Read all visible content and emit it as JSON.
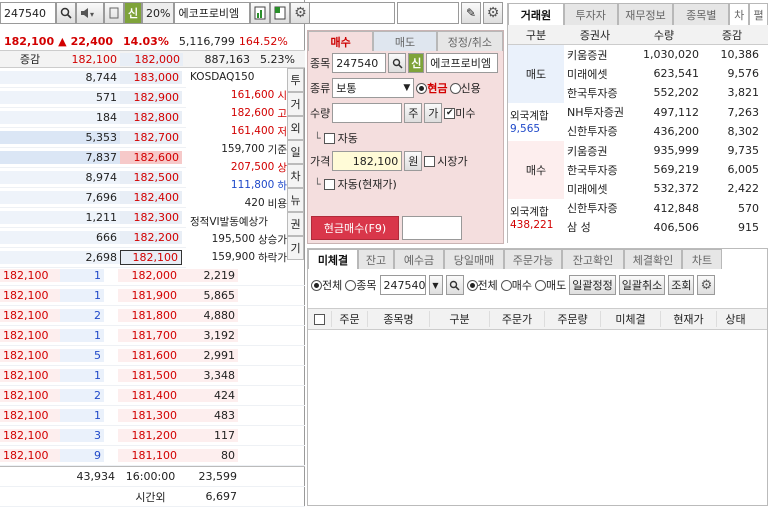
{
  "colors": {
    "accent_red": "#d20000",
    "accent_blue": "#1f49c9",
    "ask_bg": "#eaf1fb",
    "bid_bg": "#fdeeee",
    "buy_panel": "#f4dede",
    "brand_green": "#6a9a2a"
  },
  "left": {
    "code": "247540",
    "badge": "신",
    "pct_badge": "20%",
    "stock_name": "에코프로비엠",
    "price": "182,100",
    "arrow": "▲",
    "change": "22,400",
    "change_pct": "14.03%",
    "volume": "5,116,799",
    "vol_ratio": "164.52%",
    "hdr_label": "증감",
    "hdr_price_l": "182,100",
    "hdr_price_m": "182,000",
    "hdr_right": "887,163",
    "hdr_right2": "5.23%",
    "asks": [
      {
        "qty": "8,744",
        "price": "183,000"
      },
      {
        "qty": "571",
        "price": "182,900"
      },
      {
        "qty": "184",
        "price": "182,800"
      },
      {
        "qty": "5,353",
        "price": "182,700"
      },
      {
        "qty": "7,837",
        "price": "182,600"
      },
      {
        "qty": "8,974",
        "price": "182,500"
      },
      {
        "qty": "7,696",
        "price": "182,400"
      },
      {
        "qty": "1,211",
        "price": "182,300"
      },
      {
        "qty": "666",
        "price": "182,200"
      },
      {
        "qty": "2,698",
        "price": "182,100"
      }
    ],
    "info_lines": [
      {
        "label": "KOSDAQ150",
        "val": ""
      },
      {
        "label": "시",
        "val": "161,600"
      },
      {
        "label": "고",
        "val": "182,600"
      },
      {
        "label": "저",
        "val": "161,400"
      },
      {
        "label": "기준",
        "val": "159,700"
      },
      {
        "label": "상",
        "val": "207,500"
      },
      {
        "label": "하",
        "val": "111,800"
      },
      {
        "label": "비용",
        "val": "420"
      },
      {
        "label": "정적VI발동예상가",
        "val": ""
      },
      {
        "label": "상승가",
        "val": "195,500"
      },
      {
        "label": "하락가",
        "val": "159,900"
      }
    ],
    "side_tabs": [
      "투",
      "거",
      "외",
      "일",
      "차",
      "뉴",
      "권",
      "기"
    ],
    "bids": [
      {
        "p": "182,100",
        "n": "1",
        "price": "182,000",
        "qty": "2,219"
      },
      {
        "p": "182,100",
        "n": "1",
        "price": "181,900",
        "qty": "5,865"
      },
      {
        "p": "182,100",
        "n": "2",
        "price": "181,800",
        "qty": "4,880"
      },
      {
        "p": "182,100",
        "n": "1",
        "price": "181,700",
        "qty": "3,192"
      },
      {
        "p": "182,100",
        "n": "5",
        "price": "181,600",
        "qty": "2,991"
      },
      {
        "p": "182,100",
        "n": "1",
        "price": "181,500",
        "qty": "3,348"
      },
      {
        "p": "182,100",
        "n": "2",
        "price": "181,400",
        "qty": "424"
      },
      {
        "p": "182,100",
        "n": "1",
        "price": "181,300",
        "qty": "483"
      },
      {
        "p": "182,100",
        "n": "3",
        "price": "181,200",
        "qty": "117"
      },
      {
        "p": "182,100",
        "n": "9",
        "price": "181,100",
        "qty": "80"
      }
    ],
    "total_ask": "43,934",
    "time": "16:00:00",
    "total_bid": "23,599",
    "after_label": "시간외",
    "after_val": "6,697"
  },
  "order": {
    "tabs": [
      "매수",
      "매도",
      "정정/취소"
    ],
    "code_label": "종목",
    "code": "247540",
    "badge": "신",
    "name": "에코프로비엠",
    "type_label": "종류",
    "type_val": "보통",
    "cash": "현금",
    "credit": "신용",
    "qty_label": "수량",
    "btn_ju": "주",
    "btn_ga": "가",
    "unfilled": "미수",
    "auto": "자동",
    "price_label": "가격",
    "price_val": "182,100",
    "won": "원",
    "market": "시장가",
    "auto2": "자동(현재가)",
    "submit": "현금매수(F9)"
  },
  "broker": {
    "tabs": [
      "거래원",
      "투자자",
      "재무정보",
      "종목별",
      "차",
      "펼"
    ],
    "headers": [
      "구분",
      "증권사",
      "수량",
      "증감"
    ],
    "sell_label": "매도",
    "buy_label": "매수",
    "sells": [
      {
        "name": "키움증권",
        "qty": "1,030,020",
        "chg": "10,386"
      },
      {
        "name": "미래에셋",
        "qty": "623,541",
        "chg": "9,576"
      },
      {
        "name": "한국투자증",
        "qty": "552,202",
        "chg": "3,821"
      },
      {
        "name": "NH투자증권",
        "qty": "497,112",
        "chg": "7,263"
      },
      {
        "name": "신한투자증",
        "qty": "436,200",
        "chg": "8,302"
      }
    ],
    "buys": [
      {
        "name": "키움증권",
        "qty": "935,999",
        "chg": "9,735"
      },
      {
        "name": "한국투자증",
        "qty": "569,219",
        "chg": "6,005"
      },
      {
        "name": "미래에셋",
        "qty": "532,372",
        "chg": "2,422"
      },
      {
        "name": "신한투자증",
        "qty": "412,848",
        "chg": "570"
      },
      {
        "name": "삼   성",
        "qty": "406,506",
        "chg": "915"
      }
    ],
    "foreign_label": "외국계합",
    "foreign_sell": "9,565",
    "foreign_buy": "438,221"
  },
  "bottom": {
    "tabs": [
      "미체결",
      "잔고",
      "예수금",
      "당일매매",
      "주문가능",
      "잔고확인",
      "체결확인",
      "차트"
    ],
    "all": "전체",
    "stock": "종목",
    "code": "247540",
    "all2": "전체",
    "buy": "매수",
    "sell": "매도",
    "btn_modify": "일괄정정",
    "btn_cancel": "일괄취소",
    "btn_query": "조회",
    "headers": [
      "주문",
      "종목명",
      "구분",
      "주문가",
      "주문량",
      "미체결",
      "현재가",
      "상태"
    ]
  }
}
